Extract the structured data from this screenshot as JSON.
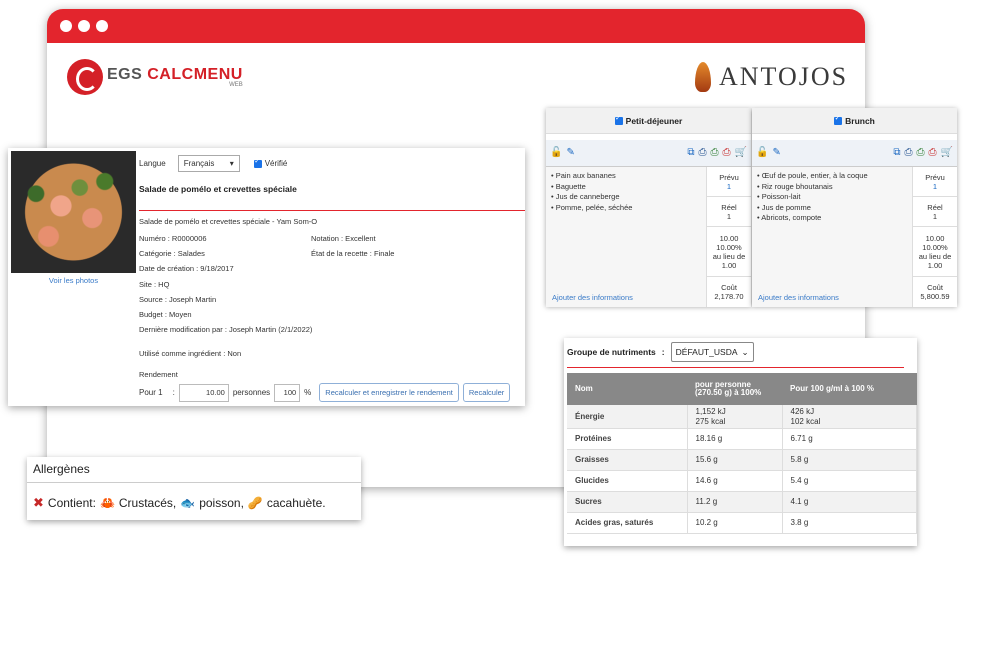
{
  "brands": {
    "left_logo_a": "EGS",
    "left_logo_b": "CALCMENU",
    "left_logo_sub": "WEB",
    "right_logo": "ANTOJOS"
  },
  "recipe": {
    "see_photos": "Voir les photos",
    "language_label": "Langue",
    "language_value": "Français",
    "verified_label": "Vérifié",
    "title": "Salade de pomélo et crevettes spéciale",
    "subtitle": "Salade de pomélo et crevettes spéciale - Yam Som-O",
    "number": "Numéro : R0000006",
    "rating": "Notation : Excellent",
    "category_label": "Catégorie :",
    "category_value": "Salades",
    "state": "État de la recette : Finale",
    "created": "Date de création : 9/18/2017",
    "site": "Site : HQ",
    "source": "Source : Joseph Martin",
    "budget": "Budget : Moyen",
    "last_modified": "Dernière modification par : Joseph Martin (2/1/2022)",
    "used_as_ingredient": "Utilisé comme ingrédient : Non",
    "yield_label": "Rendement",
    "for_label": "Pour 1",
    "colon": ":",
    "yield_value": "10.00",
    "persons_label": "personnes",
    "percent_value": "100",
    "percent_sign": "%",
    "btn_recalc_save": "Recalculer et enregistrer le rendement",
    "btn_recalc": "Recalculer"
  },
  "allergens": {
    "title": "Allergènes",
    "contains_label": "Contient:",
    "items": [
      {
        "icon": "crab-icon",
        "label": "Crustacés,"
      },
      {
        "icon": "fish-icon",
        "label": "poisson,"
      },
      {
        "icon": "peanut-icon",
        "label": "cacahuète."
      }
    ]
  },
  "meals": [
    {
      "name": "Petit-déjeuner",
      "items": [
        "• Pain aux bananes",
        "• Baguette",
        "• Jus de canneberge",
        "• Pomme, pelée, séchée"
      ],
      "planned_label": "Prévu",
      "planned_value": "1",
      "actual_label": "Réel",
      "actual_value": "1",
      "pct_value": "10.00",
      "pct_pct": "10.00%",
      "pct_instead": "au lieu de",
      "pct_base": "1.00",
      "cost_label": "Coût",
      "cost_value": "2,178.70",
      "add_info": "Ajouter des informations"
    },
    {
      "name": "Brunch",
      "items": [
        "• Œuf de poule, entier, à la coque",
        "• Riz rouge bhoutanais",
        "• Poisson-lait",
        "• Jus de pomme",
        "• Abricots, compote"
      ],
      "planned_label": "Prévu",
      "planned_value": "1",
      "actual_label": "Réel",
      "actual_value": "1",
      "pct_value": "10.00",
      "pct_pct": "10.00%",
      "pct_instead": "au lieu de",
      "pct_base": "1.00",
      "cost_label": "Coût",
      "cost_value": "5,800.59",
      "add_info": "Ajouter des informations"
    }
  ],
  "nutrients": {
    "group_label": "Groupe de nutriments",
    "colon": ":",
    "group_value": "DÉFAUT_USDA",
    "headers": [
      "Nom",
      "pour personne (270.50 g) à 100%",
      "Pour 100 g/ml à 100 %"
    ],
    "rows": [
      {
        "name": "Énergie",
        "per_person": "1,152 kJ",
        "per_person2": "275 kcal",
        "per_100": "426 kJ",
        "per_100b": "102 kcal"
      },
      {
        "name": "Protéines",
        "per_person": "18.16 g",
        "per_person2": "",
        "per_100": "6.71 g",
        "per_100b": ""
      },
      {
        "name": "Graisses",
        "per_person": "15.6 g",
        "per_person2": "",
        "per_100": "5.8 g",
        "per_100b": ""
      },
      {
        "name": "Glucides",
        "per_person": "14.6 g",
        "per_person2": "",
        "per_100": "5.4 g",
        "per_100b": ""
      },
      {
        "name": "Sucres",
        "per_person": "11.2 g",
        "per_person2": "",
        "per_100": "4.1 g",
        "per_100b": ""
      },
      {
        "name": "Acides gras, saturés",
        "per_person": "10.2 g",
        "per_person2": "",
        "per_100": "3.8 g",
        "per_100b": ""
      }
    ]
  },
  "colors": {
    "brand_red": "#e3252d",
    "link_blue": "#3a7bc8"
  }
}
